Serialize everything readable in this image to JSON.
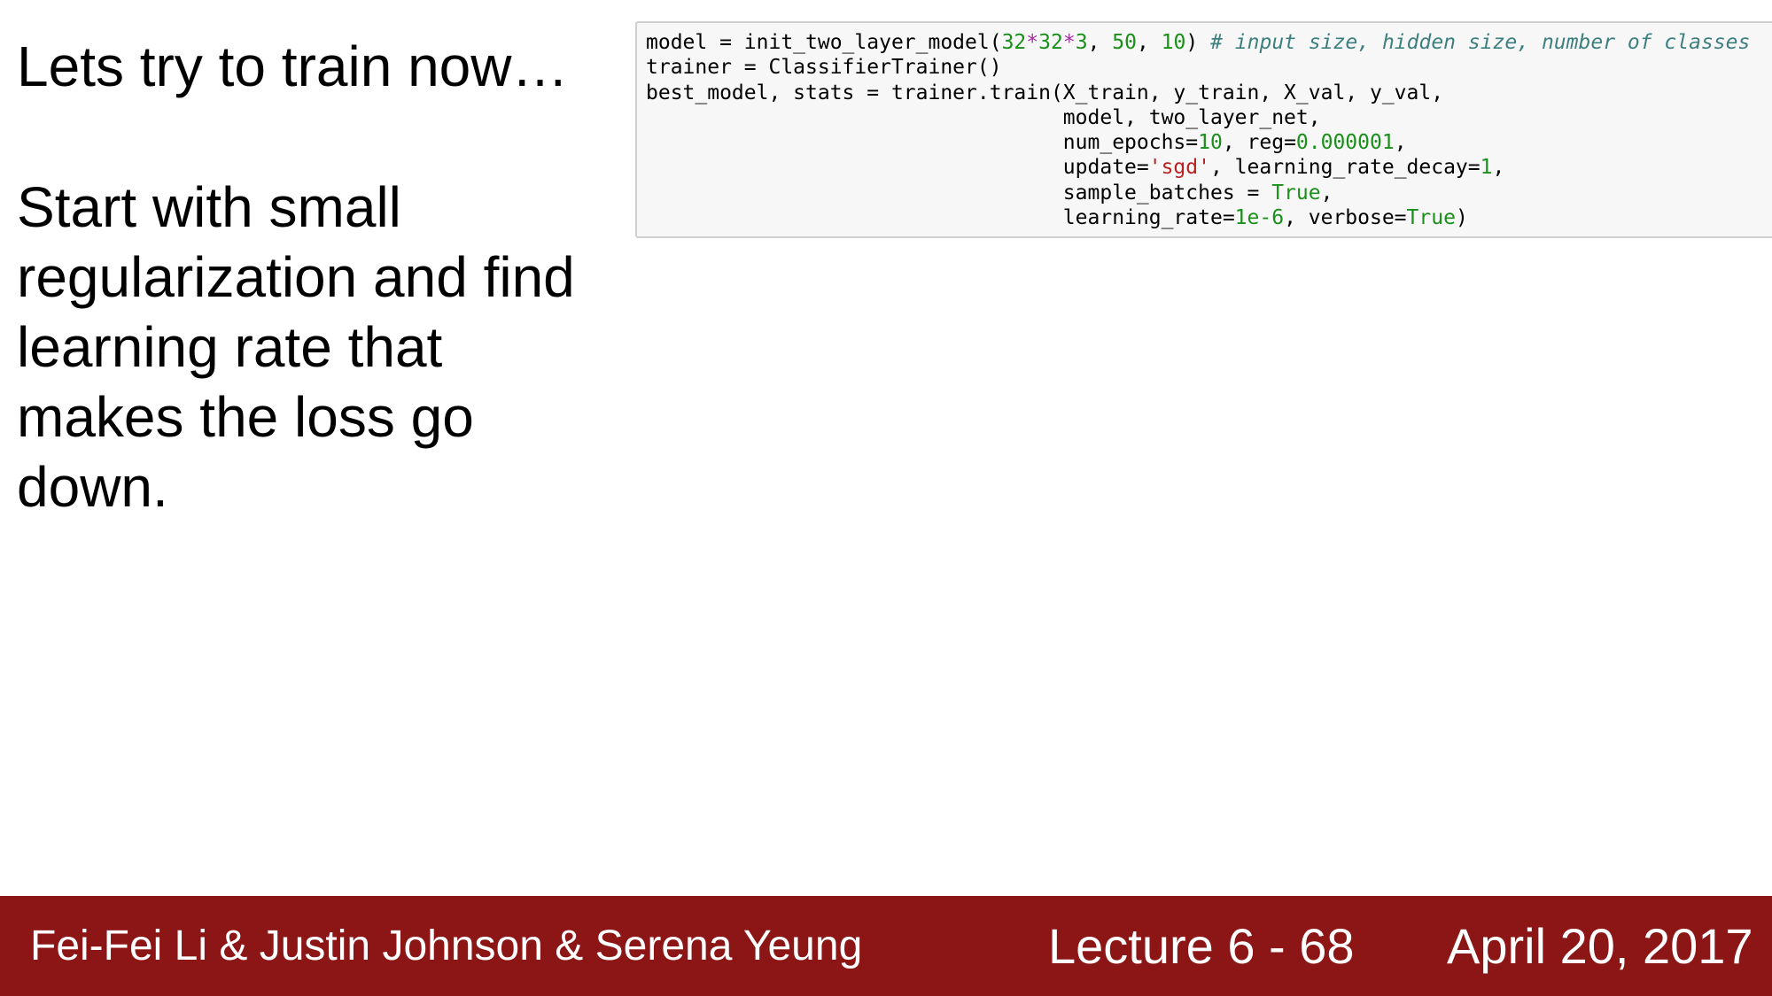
{
  "slide": {
    "title": "Lets try to train now…",
    "body_lines": [
      "Start with small",
      "regularization and find",
      "learning rate that",
      "makes the loss go",
      "down."
    ]
  },
  "code": {
    "line1": {
      "a": "model = init_two_layer_model(",
      "n1": "32",
      "o1": "*",
      "n2": "32",
      "o2": "*",
      "n3": "3",
      "b": ", ",
      "n4": "50",
      "c": ", ",
      "n5": "10",
      "d": ") ",
      "comment": "# input size, hidden size, number of classes"
    },
    "line2": "trainer = ClassifierTrainer()",
    "line3": "best_model, stats = trainer.train(X_train, y_train, X_val, y_val,",
    "line4": "                                  model, two_layer_net,",
    "line5": {
      "a": "                                  num_epochs=",
      "n1": "10",
      "b": ", reg=",
      "n2": "0.000001",
      "c": ","
    },
    "line6": {
      "a": "                                  update=",
      "s1": "'sgd'",
      "b": ", learning_rate_decay=",
      "n1": "1",
      "c": ","
    },
    "line7": {
      "a": "                                  sample_batches = ",
      "k1": "True",
      "b": ","
    },
    "line8": {
      "a": "                                  learning_rate=",
      "n1": "1e-6",
      "b": ", verbose=",
      "k1": "True",
      "c": ")"
    }
  },
  "footer": {
    "authors": "Fei-Fei Li & Justin Johnson & Serena Yeung",
    "lecture": "Lecture 6 - 68",
    "date": "April 20, 2017"
  }
}
